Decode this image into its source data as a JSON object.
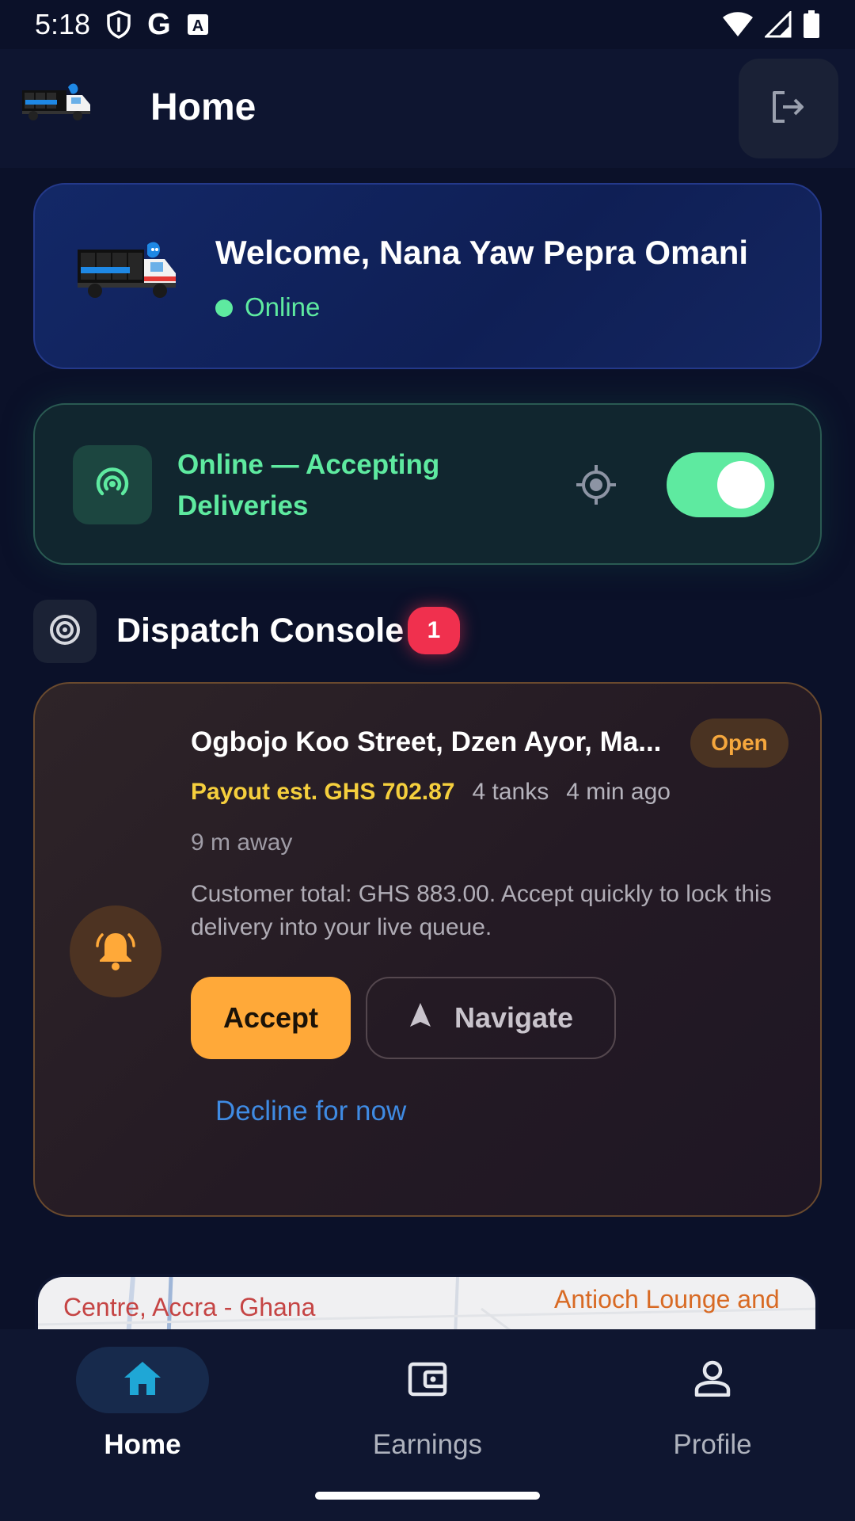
{
  "status_bar": {
    "time": "5:18",
    "left_icons": [
      "shield-icon",
      "google-g-icon",
      "font-a-icon"
    ],
    "right_icons": [
      "wifi-icon",
      "cell-signal-icon",
      "battery-icon"
    ]
  },
  "app_bar": {
    "title": "Home",
    "logo_icon": "water-truck-logo",
    "logout_icon": "logout-icon"
  },
  "welcome": {
    "title": "Welcome, Nana Yaw Pepra Omani",
    "status": "Online",
    "status_color": "#5eeaa0"
  },
  "availability": {
    "label": "Online — Accepting Deliveries",
    "toggle_on": true,
    "icon": "radar-icon",
    "locate_icon": "target-icon"
  },
  "dispatch": {
    "title": "Dispatch Console",
    "badge_count": "1",
    "icon": "bullseye-icon"
  },
  "delivery": {
    "address": "Ogbojo Koo Street, Dzen Ayor, Ma...",
    "status": "Open",
    "payout": "Payout est. GHS 702.87",
    "tanks": "4 tanks",
    "time_ago": "4 min ago",
    "distance": "9 m away",
    "description": "Customer total: GHS 883.00. Accept quickly to lock this delivery into your live queue.",
    "accept_label": "Accept",
    "navigate_label": "Navigate",
    "decline_label": "Decline for now",
    "bell_icon": "bell-icon"
  },
  "map": {
    "label_left": "Centre, Accra - Ghana",
    "label_right": "Antioch Lounge and"
  },
  "bottom_nav": {
    "items": [
      {
        "label": "Home",
        "icon": "home-icon",
        "active": true
      },
      {
        "label": "Earnings",
        "icon": "wallet-icon",
        "active": false
      },
      {
        "label": "Profile",
        "icon": "person-icon",
        "active": false
      }
    ]
  },
  "colors": {
    "background": "#0b1129",
    "accent_green": "#5eeaa0",
    "accent_orange": "#ffa939",
    "badge_red": "#f0304e",
    "link_blue": "#3f8be3"
  }
}
